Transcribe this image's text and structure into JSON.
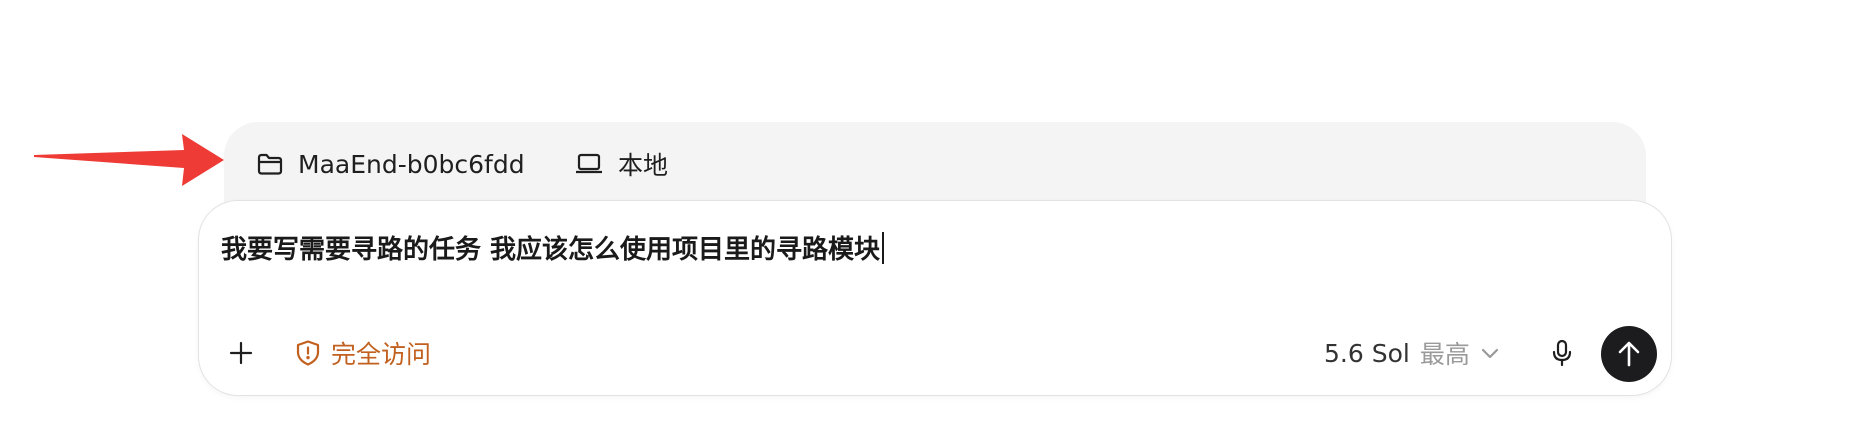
{
  "context": {
    "folder_label": "MaaEnd-b0bc6fdd",
    "folder_icon": "folder-icon",
    "env_label": "本地",
    "env_icon": "laptop-icon"
  },
  "composer": {
    "prompt_text": "我要写需要寻路的任务 我应该怎么使用项目里的寻路模块",
    "add_icon": "plus-icon",
    "access_label": "完全访问",
    "access_icon": "shield-alert-icon",
    "access_color": "#c2611f",
    "model_name": "5.6 Sol",
    "model_level": "最高",
    "mic_icon": "microphone-icon",
    "send_icon": "arrow-up-icon"
  },
  "annotation": {
    "arrow_color": "#ee3b36"
  }
}
